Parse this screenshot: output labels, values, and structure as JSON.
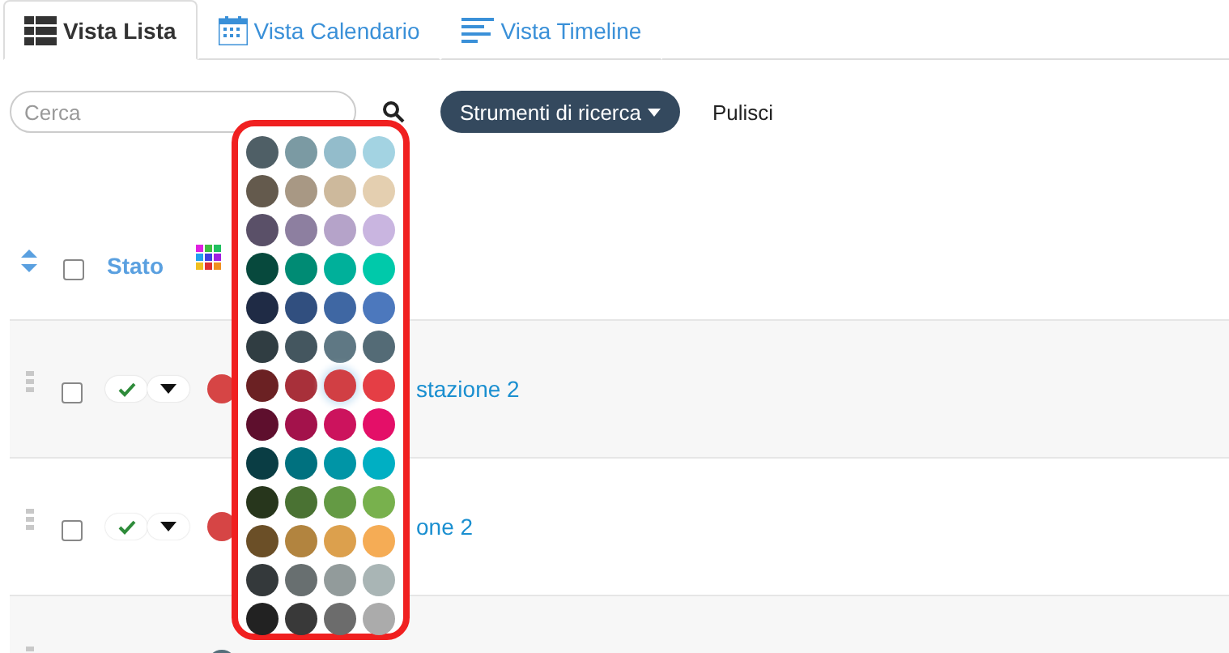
{
  "tabs": [
    {
      "label": "Vista Lista",
      "kind": "list",
      "selected": true
    },
    {
      "label": "Vista Calendario",
      "kind": "calendar",
      "selected": false
    },
    {
      "label": "Vista Timeline",
      "kind": "timeline",
      "selected": false
    }
  ],
  "search": {
    "placeholder": "Cerca"
  },
  "buttons": [
    {
      "label": "Strumenti di ricerca",
      "kind": "dropdown"
    },
    {
      "label": "Pulisci",
      "kind": "plain"
    }
  ],
  "table": {
    "columns": [
      "Stato"
    ],
    "all_checked": false,
    "rows": [
      {
        "checked": false,
        "color": "#d64545",
        "title": "stazione 2"
      },
      {
        "checked": false,
        "color": "#d64545",
        "title": "one 2"
      },
      {
        "color": "#546e7a"
      }
    ]
  },
  "palette": [
    {
      "color": "#4f5f66",
      "selected": false
    },
    {
      "color": "#7b9aa3",
      "selected": false
    },
    {
      "color": "#93bccb",
      "selected": false
    },
    {
      "color": "#a3d3e2",
      "selected": false
    },
    {
      "color": "#645a4d",
      "selected": false
    },
    {
      "color": "#a89884",
      "selected": false
    },
    {
      "color": "#cdb99c",
      "selected": false
    },
    {
      "color": "#e4cfb0",
      "selected": false
    },
    {
      "color": "#5a5068",
      "selected": false
    },
    {
      "color": "#8d7fa0",
      "selected": false
    },
    {
      "color": "#b5a3c9",
      "selected": false
    },
    {
      "color": "#c9b5e0",
      "selected": false
    },
    {
      "color": "#07493d",
      "selected": false
    },
    {
      "color": "#008b74",
      "selected": false
    },
    {
      "color": "#00b09a",
      "selected": false
    },
    {
      "color": "#00c9aa",
      "selected": false
    },
    {
      "color": "#1f2b45",
      "selected": false
    },
    {
      "color": "#314f7f",
      "selected": false
    },
    {
      "color": "#3f67a3",
      "selected": false
    },
    {
      "color": "#4c78bd",
      "selected": false
    },
    {
      "color": "#303d42",
      "selected": false
    },
    {
      "color": "#44565f",
      "selected": false
    },
    {
      "color": "#5f7884",
      "selected": false
    },
    {
      "color": "#546b76",
      "selected": false
    },
    {
      "color": "#6b2123",
      "selected": false
    },
    {
      "color": "#a8303a",
      "selected": false
    },
    {
      "color": "#d13f44",
      "selected": true
    },
    {
      "color": "#e53e45",
      "selected": false
    },
    {
      "color": "#5e0f2d",
      "selected": false
    },
    {
      "color": "#a3124b",
      "selected": false
    },
    {
      "color": "#cc135d",
      "selected": false
    },
    {
      "color": "#e40f68",
      "selected": false
    },
    {
      "color": "#0a3d44",
      "selected": false
    },
    {
      "color": "#00717f",
      "selected": false
    },
    {
      "color": "#0095a6",
      "selected": false
    },
    {
      "color": "#00afc3",
      "selected": false
    },
    {
      "color": "#27361c",
      "selected": false
    },
    {
      "color": "#4a7233",
      "selected": false
    },
    {
      "color": "#649a44",
      "selected": false
    },
    {
      "color": "#78b14d",
      "selected": false
    },
    {
      "color": "#6b4f27",
      "selected": false
    },
    {
      "color": "#b2843f",
      "selected": false
    },
    {
      "color": "#dca04d",
      "selected": false
    },
    {
      "color": "#f5ac55",
      "selected": false
    },
    {
      "color": "#34393b",
      "selected": false
    },
    {
      "color": "#686f70",
      "selected": false
    },
    {
      "color": "#929b9b",
      "selected": false
    },
    {
      "color": "#a9b5b5",
      "selected": false
    },
    {
      "color": "#222222",
      "selected": false
    },
    {
      "color": "#393939",
      "selected": false
    },
    {
      "color": "#6c6c6c",
      "selected": false
    },
    {
      "color": "#ababab",
      "selected": false
    }
  ]
}
